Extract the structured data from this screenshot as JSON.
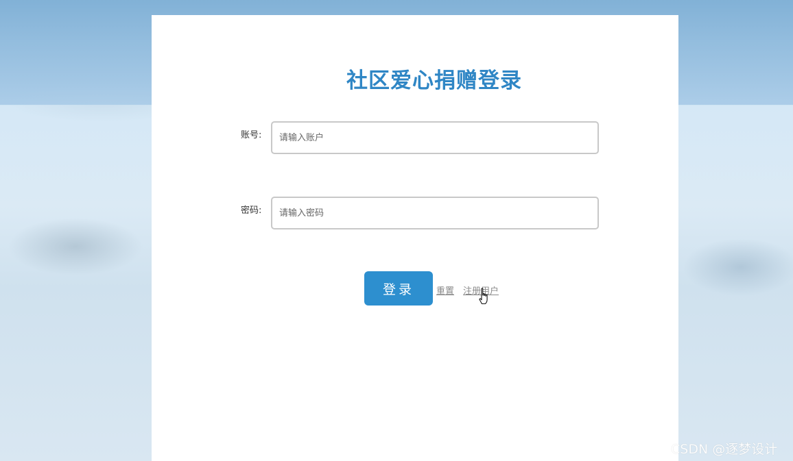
{
  "page": {
    "title": "社区爱心捐赠登录"
  },
  "form": {
    "account": {
      "label": "账号:",
      "placeholder": "请输入账户",
      "value": ""
    },
    "password": {
      "label": "密码:",
      "placeholder": "请输入密码",
      "value": ""
    }
  },
  "actions": {
    "login_label": "登录",
    "reset_label": "重置",
    "register_label": "注册用户"
  },
  "cursor": {
    "icon": "hand-pointer-icon"
  },
  "watermark": {
    "text": "CSDN @逐梦设计"
  },
  "colors": {
    "title": "#2f86c5",
    "login_button": "#2d8fcf",
    "panel": "#ffffff",
    "link": "#8a8a8a"
  }
}
